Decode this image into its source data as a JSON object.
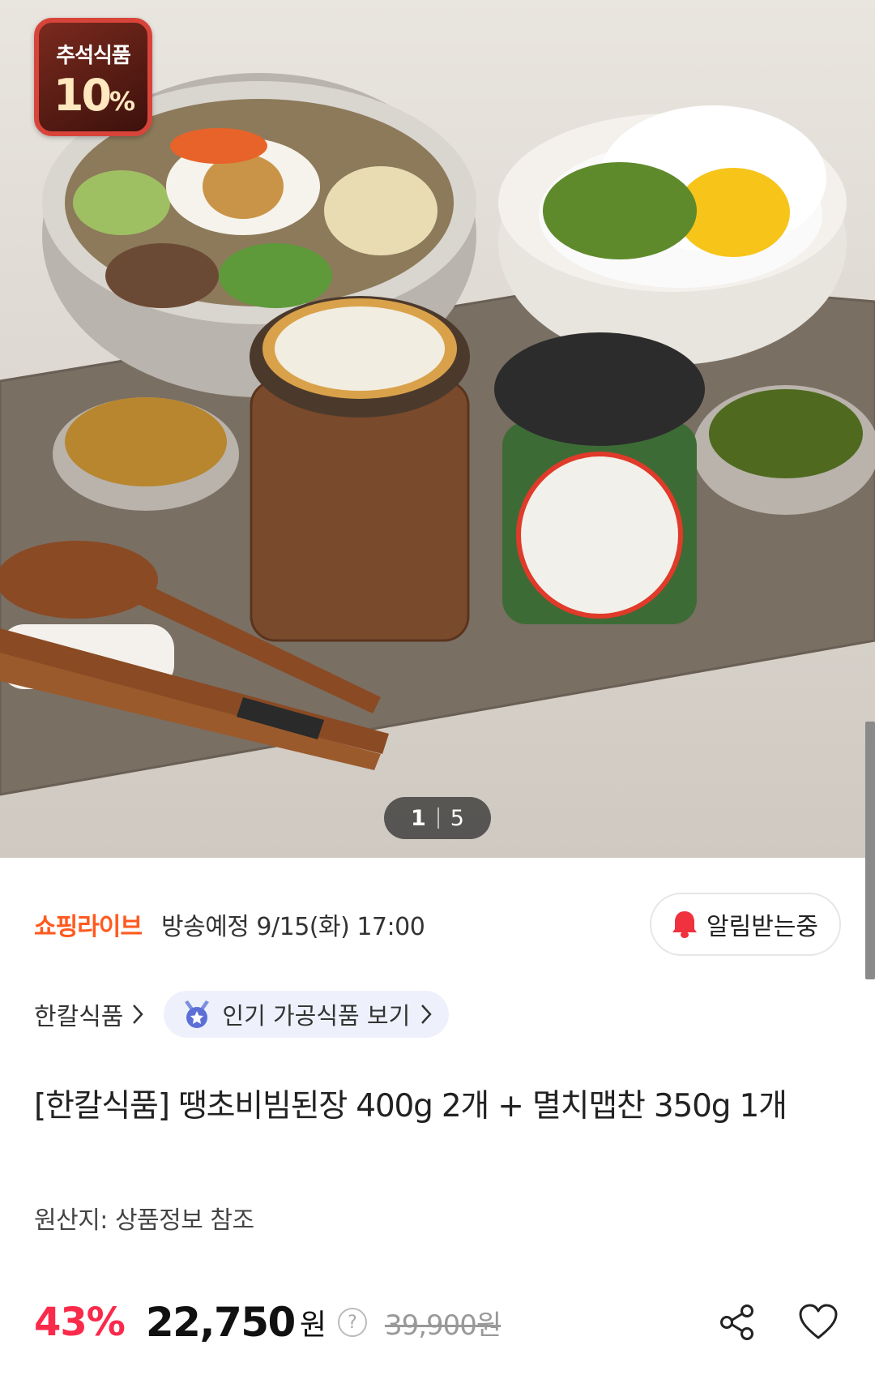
{
  "hero": {
    "badge": {
      "top_text": "추석식품",
      "main_text": "10",
      "suffix": "%"
    },
    "counter": {
      "current": "1",
      "total": "5"
    }
  },
  "live": {
    "brand": "쇼핑라이브",
    "schedule": "방송예정 9/15(화) 17:00",
    "alarm_label": "알림받는중"
  },
  "store": {
    "name": "한칼식품",
    "chip_label": "인기 가공식품 보기"
  },
  "product": {
    "title": "[한칼식품] 땡초비빔된장 400g 2개 + 멸치맵찬 350g 1개",
    "origin": "원산지: 상품정보 참조"
  },
  "price": {
    "discount": "43%",
    "sale": "22,750",
    "unit": "원",
    "help": "?",
    "original": "39,900원"
  },
  "colors": {
    "accent_orange": "#ff5a1f",
    "discount_red": "#fa2a4a",
    "bell_red": "#f0313e",
    "chip_bg": "#eef1fb"
  }
}
